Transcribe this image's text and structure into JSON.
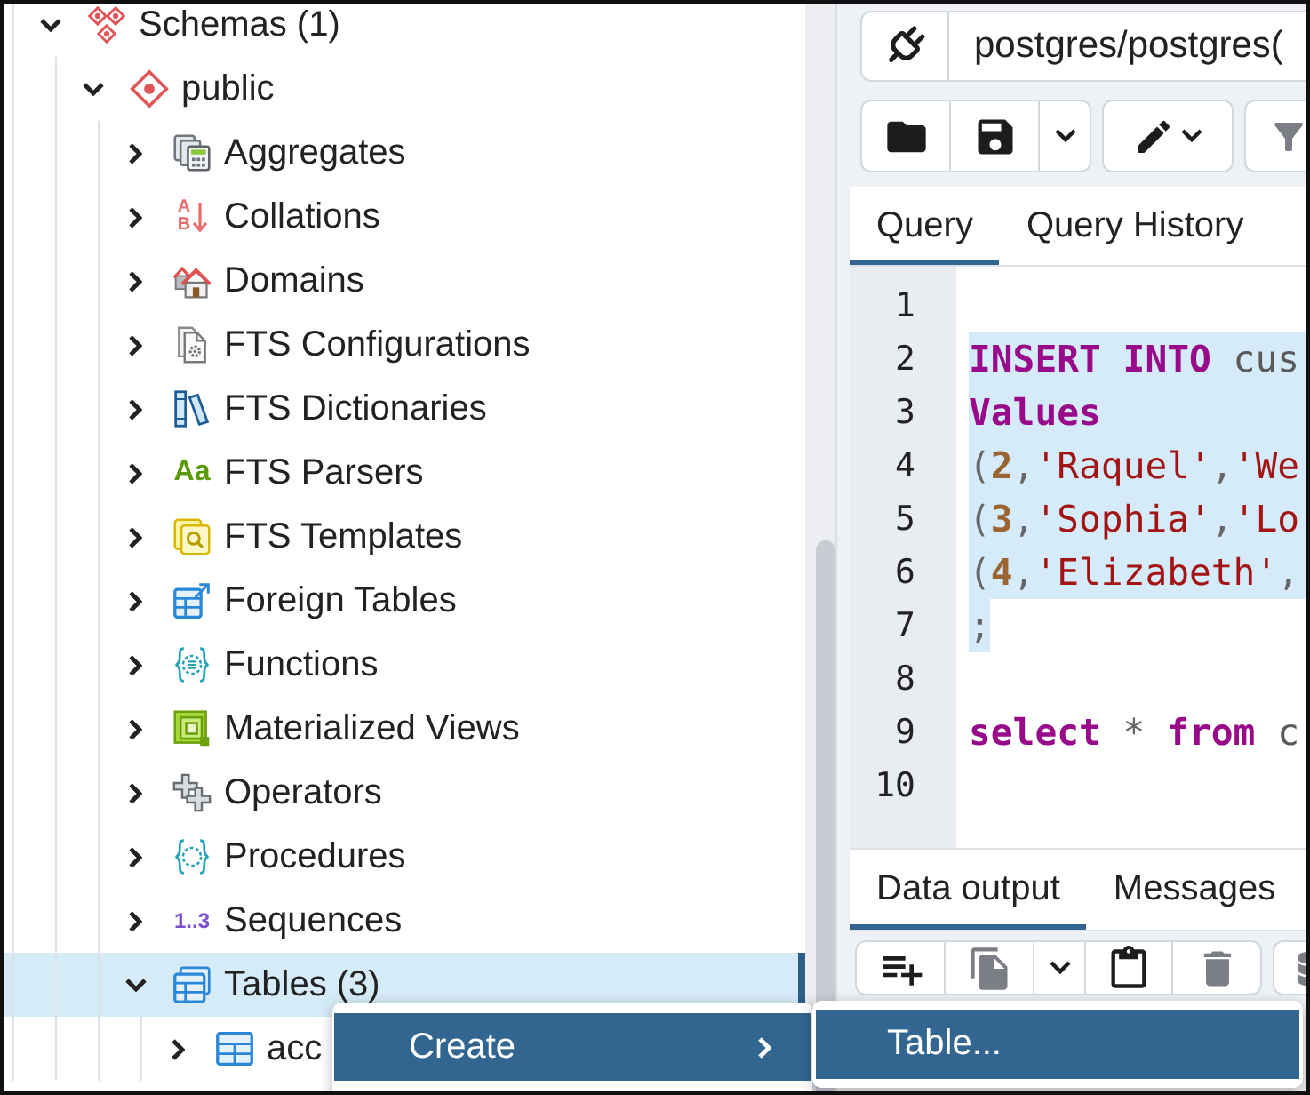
{
  "tree": [
    {
      "label": "Schemas (1)",
      "kind": "schemas",
      "expanded": true,
      "selected": false,
      "children": [
        {
          "label": "public",
          "kind": "schema",
          "expanded": true,
          "selected": false,
          "children": [
            {
              "label": "Aggregates",
              "kind": "aggregates",
              "expanded": false,
              "selected": false
            },
            {
              "label": "Collations",
              "kind": "collations",
              "icon_text": "AB",
              "expanded": false,
              "selected": false
            },
            {
              "label": "Domains",
              "kind": "domains",
              "expanded": false,
              "selected": false
            },
            {
              "label": "FTS Configurations",
              "kind": "fts_configurations",
              "expanded": false,
              "selected": false
            },
            {
              "label": "FTS Dictionaries",
              "kind": "fts_dictionaries",
              "expanded": false,
              "selected": false
            },
            {
              "label": "FTS Parsers",
              "kind": "fts_parsers",
              "icon_text": "Aa",
              "expanded": false,
              "selected": false
            },
            {
              "label": "FTS Templates",
              "kind": "fts_templates",
              "expanded": false,
              "selected": false
            },
            {
              "label": "Foreign Tables",
              "kind": "foreign_tables",
              "expanded": false,
              "selected": false
            },
            {
              "label": "Functions",
              "kind": "functions",
              "expanded": false,
              "selected": false
            },
            {
              "label": "Materialized Views",
              "kind": "materialized_views",
              "expanded": false,
              "selected": false
            },
            {
              "label": "Operators",
              "kind": "operators",
              "expanded": false,
              "selected": false
            },
            {
              "label": "Procedures",
              "kind": "procedures",
              "expanded": false,
              "selected": false
            },
            {
              "label": "Sequences",
              "kind": "sequences",
              "icon_text": "1..3",
              "expanded": false,
              "selected": false
            },
            {
              "label": "Tables (3)",
              "kind": "tables",
              "expanded": true,
              "selected": true,
              "children": [
                {
                  "label": "acc",
                  "kind": "table",
                  "expanded": false,
                  "selected": false
                }
              ]
            }
          ]
        }
      ]
    }
  ],
  "connection": {
    "label": "postgres/postgres("
  },
  "toolbar": [
    {
      "buttons": [
        {
          "kind": "open",
          "disabled": false
        },
        {
          "kind": "save",
          "disabled": false
        },
        {
          "kind": "dropdown",
          "disabled": false
        }
      ]
    },
    {
      "buttons": [
        {
          "kind": "edit",
          "disabled": false
        }
      ]
    },
    {
      "buttons": [
        {
          "kind": "filter",
          "disabled": true
        }
      ]
    }
  ],
  "query_tabs": [
    {
      "label": "Query",
      "selected": true
    },
    {
      "label": "Query History",
      "selected": false
    }
  ],
  "editor": {
    "lines": [
      {
        "number": "1",
        "selected": false
      },
      {
        "number": "2",
        "selected": true,
        "tokens": [
          {
            "kind": "keyword",
            "text": "INSERT INTO"
          },
          {
            "kind": "plain",
            "text": " cus"
          }
        ]
      },
      {
        "number": "3",
        "selected": true,
        "tokens": [
          {
            "kind": "keyword",
            "text": "Values"
          }
        ]
      },
      {
        "number": "4",
        "selected": true,
        "tokens": [
          {
            "kind": "punct",
            "text": "("
          },
          {
            "kind": "number",
            "text": "2"
          },
          {
            "kind": "punct",
            "text": ","
          },
          {
            "kind": "string",
            "text": "'Raquel'"
          },
          {
            "kind": "punct",
            "text": ","
          },
          {
            "kind": "string",
            "text": "'We"
          }
        ]
      },
      {
        "number": "5",
        "selected": true,
        "tokens": [
          {
            "kind": "punct",
            "text": "("
          },
          {
            "kind": "number",
            "text": "3"
          },
          {
            "kind": "punct",
            "text": ","
          },
          {
            "kind": "string",
            "text": "'Sophia'"
          },
          {
            "kind": "punct",
            "text": ","
          },
          {
            "kind": "string",
            "text": "'Lo"
          }
        ]
      },
      {
        "number": "6",
        "selected": true,
        "tokens": [
          {
            "kind": "punct",
            "text": "("
          },
          {
            "kind": "number",
            "text": "4"
          },
          {
            "kind": "punct",
            "text": ","
          },
          {
            "kind": "string",
            "text": "'Elizabeth'"
          },
          {
            "kind": "punct",
            "text": ","
          }
        ]
      },
      {
        "number": "7",
        "selected": true,
        "tokens": [
          {
            "kind": "punct",
            "text": ";"
          }
        ]
      },
      {
        "number": "8",
        "selected": false
      },
      {
        "number": "9",
        "selected": false,
        "tokens": [
          {
            "kind": "keyword",
            "text": "select"
          },
          {
            "kind": "punct",
            "text": " * "
          },
          {
            "kind": "keyword",
            "text": "from"
          },
          {
            "kind": "plain",
            "text": " c"
          }
        ]
      },
      {
        "number": "10",
        "selected": false
      }
    ]
  },
  "output_tabs": [
    {
      "label": "Data output",
      "selected": true
    },
    {
      "label": "Messages",
      "selected": false
    }
  ],
  "results_toolbar": [
    {
      "buttons": [
        {
          "kind": "add_row",
          "disabled": false
        },
        {
          "kind": "copy",
          "disabled": true
        },
        {
          "kind": "dropdown",
          "disabled": false
        },
        {
          "kind": "paste",
          "disabled": false
        },
        {
          "kind": "delete",
          "disabled": true
        }
      ]
    },
    {
      "buttons": [
        {
          "kind": "database",
          "disabled": true
        }
      ]
    }
  ],
  "context_menu": [
    {
      "label": "Create",
      "selected": true,
      "submenu": true
    }
  ],
  "submenu": [
    {
      "label": "Table...",
      "selected": true
    }
  ]
}
